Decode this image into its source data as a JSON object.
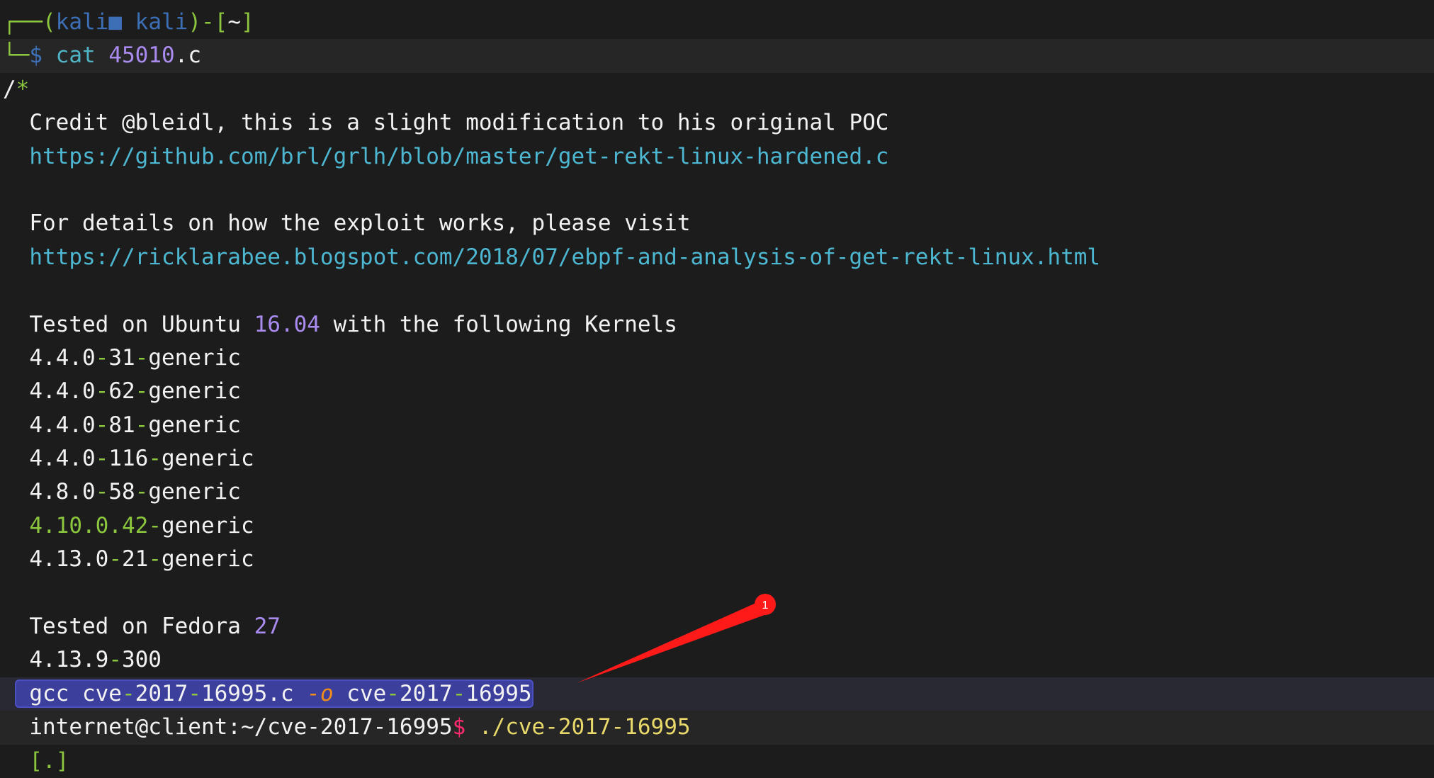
{
  "terminal": {
    "lines": [
      {
        "style": "",
        "segments": [
          {
            "t": "┌──",
            "c": "tree"
          },
          {
            "t": "(",
            "c": "g"
          },
          {
            "t": "kali",
            "c": "b"
          },
          {
            "t": "■",
            "c": "b"
          },
          {
            "t": " kali",
            "c": "b"
          },
          {
            "t": ")-[",
            "c": "g"
          },
          {
            "t": "~",
            "c": "w"
          },
          {
            "t": "]",
            "c": "g"
          }
        ]
      },
      {
        "style": "hl",
        "segments": [
          {
            "t": "└─",
            "c": "tree"
          },
          {
            "t": "$",
            "c": "b"
          },
          {
            "t": " cat ",
            "c": "c"
          },
          {
            "t": "45010",
            "c": "p"
          },
          {
            "t": ".c",
            "c": "w"
          }
        ]
      },
      {
        "style": "",
        "segments": [
          {
            "t": "/",
            "c": "w"
          },
          {
            "t": "*",
            "c": "g"
          }
        ]
      },
      {
        "style": "",
        "segments": [
          {
            "t": "  Credit @bleidl, this is a slight modification to his original POC",
            "c": "w"
          }
        ]
      },
      {
        "style": "",
        "segments": [
          {
            "t": "  https://github.com/brl/grlh/blob/master/get-rekt-linux-hardened.c",
            "c": "u"
          }
        ]
      },
      {
        "style": "",
        "segments": []
      },
      {
        "style": "",
        "segments": [
          {
            "t": "  For details on how the exploit works, please visit",
            "c": "w"
          }
        ]
      },
      {
        "style": "",
        "segments": [
          {
            "t": "  https://ricklarabee.blogspot.com/2018/07/ebpf-and-analysis-of-get-rekt-linux.html",
            "c": "u"
          }
        ]
      },
      {
        "style": "",
        "segments": []
      },
      {
        "style": "",
        "segments": [
          {
            "t": "  Tested on Ubuntu ",
            "c": "w"
          },
          {
            "t": "16.04",
            "c": "p"
          },
          {
            "t": " with the following Kernels",
            "c": "w"
          }
        ]
      },
      {
        "style": "",
        "segments": [
          {
            "t": "  4.4.0",
            "c": "w"
          },
          {
            "t": "-",
            "c": "g"
          },
          {
            "t": "31",
            "c": "w"
          },
          {
            "t": "-",
            "c": "g"
          },
          {
            "t": "generic",
            "c": "w"
          }
        ]
      },
      {
        "style": "",
        "segments": [
          {
            "t": "  4.4.0",
            "c": "w"
          },
          {
            "t": "-",
            "c": "g"
          },
          {
            "t": "62",
            "c": "w"
          },
          {
            "t": "-",
            "c": "g"
          },
          {
            "t": "generic",
            "c": "w"
          }
        ]
      },
      {
        "style": "",
        "segments": [
          {
            "t": "  4.4.0",
            "c": "w"
          },
          {
            "t": "-",
            "c": "g"
          },
          {
            "t": "81",
            "c": "w"
          },
          {
            "t": "-",
            "c": "g"
          },
          {
            "t": "generic",
            "c": "w"
          }
        ]
      },
      {
        "style": "",
        "segments": [
          {
            "t": "  4.4.0",
            "c": "w"
          },
          {
            "t": "-",
            "c": "g"
          },
          {
            "t": "116",
            "c": "w"
          },
          {
            "t": "-",
            "c": "g"
          },
          {
            "t": "generic",
            "c": "w"
          }
        ]
      },
      {
        "style": "",
        "segments": [
          {
            "t": "  4.8.0",
            "c": "w"
          },
          {
            "t": "-",
            "c": "g"
          },
          {
            "t": "58",
            "c": "w"
          },
          {
            "t": "-",
            "c": "g"
          },
          {
            "t": "generic",
            "c": "w"
          }
        ]
      },
      {
        "style": "",
        "segments": [
          {
            "t": "  4.10.0.42",
            "c": "g"
          },
          {
            "t": "-",
            "c": "g"
          },
          {
            "t": "generic",
            "c": "w"
          }
        ]
      },
      {
        "style": "",
        "segments": [
          {
            "t": "  4.13.0",
            "c": "w"
          },
          {
            "t": "-",
            "c": "g"
          },
          {
            "t": "21",
            "c": "w"
          },
          {
            "t": "-",
            "c": "g"
          },
          {
            "t": "generic",
            "c": "w"
          }
        ]
      },
      {
        "style": "",
        "segments": []
      },
      {
        "style": "",
        "segments": [
          {
            "t": "  Tested on Fedora ",
            "c": "w"
          },
          {
            "t": "27",
            "c": "p"
          }
        ]
      },
      {
        "style": "",
        "segments": [
          {
            "t": "  4.13.9",
            "c": "w"
          },
          {
            "t": "-",
            "c": "g"
          },
          {
            "t": "300",
            "c": "w"
          }
        ]
      },
      {
        "style": "hl2",
        "selected": true,
        "segments": [
          {
            "t": "gcc cve",
            "c": "w"
          },
          {
            "t": "-",
            "c": "g"
          },
          {
            "t": "2017",
            "c": "w"
          },
          {
            "t": "-",
            "c": "g"
          },
          {
            "t": "16995.c ",
            "c": "w"
          },
          {
            "t": "-o",
            "c": "o"
          },
          {
            "t": " cve",
            "c": "w"
          },
          {
            "t": "-",
            "c": "g"
          },
          {
            "t": "2017",
            "c": "w"
          },
          {
            "t": "-",
            "c": "g"
          },
          {
            "t": "16995",
            "c": "w"
          }
        ]
      },
      {
        "style": "hl",
        "segments": [
          {
            "t": "  internet@client:~/cve-2017-16995",
            "c": "w"
          },
          {
            "t": "$",
            "c": "r"
          },
          {
            "t": " ./cve-2017-16995",
            "c": "y"
          }
        ]
      },
      {
        "style": "",
        "segments": [
          {
            "t": "  [.]",
            "c": "g"
          }
        ]
      }
    ]
  },
  "annotation": {
    "badge": "1",
    "color": "#ff1a1a"
  }
}
